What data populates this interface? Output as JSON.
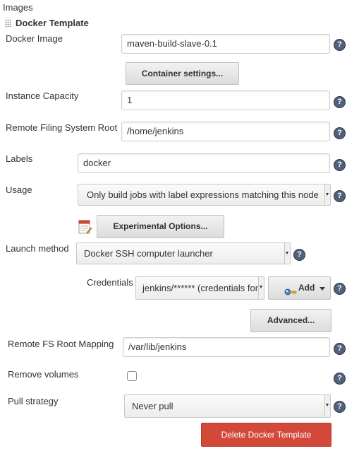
{
  "section": {
    "title": "Images"
  },
  "template": {
    "title": "Docker Template"
  },
  "fields": {
    "docker_image": {
      "label": "Docker Image",
      "value": "maven-build-slave-0.1"
    },
    "container_settings_button": "Container settings...",
    "instance_capacity": {
      "label": "Instance Capacity",
      "value": "1"
    },
    "remote_fs_root": {
      "label": "Remote Filing System Root",
      "value": "/home/jenkins"
    },
    "labels": {
      "label": "Labels",
      "value": "docker"
    },
    "usage": {
      "label": "Usage",
      "value": "Only build jobs with label expressions matching this node"
    },
    "experimental_button": "Experimental Options...",
    "launch_method": {
      "label": "Launch method",
      "value": "Docker SSH computer launcher"
    },
    "credentials": {
      "label": "Credentials",
      "value": "jenkins/****** (credentials for jenkins slave)"
    },
    "add_button": "Add",
    "advanced_button": "Advanced...",
    "remote_fs_root_mapping": {
      "label": "Remote FS Root Mapping",
      "value": "/var/lib/jenkins"
    },
    "remove_volumes": {
      "label": "Remove volumes",
      "checked": false
    },
    "pull_strategy": {
      "label": "Pull strategy",
      "value": "Never pull"
    },
    "delete_button": "Delete Docker Template"
  },
  "help_glyph": "?",
  "colors": {
    "delete_button": "#d24939",
    "help_icon": "#52617a"
  }
}
